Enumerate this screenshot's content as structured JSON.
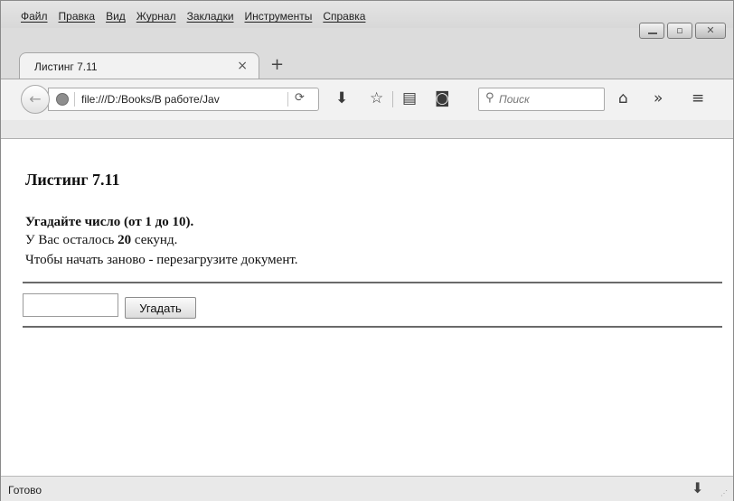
{
  "menu": {
    "items": [
      "Файл",
      "Правка",
      "Вид",
      "Журнал",
      "Закладки",
      "Инструменты",
      "Справка"
    ]
  },
  "tab": {
    "title": "Листинг 7.11",
    "close_glyph": "×",
    "new_tab_glyph": "+"
  },
  "navbar": {
    "back_glyph": "←",
    "url": "file:///D:/Books/В работе/Jav",
    "reload_glyph": "C",
    "search_placeholder": "Поиск",
    "icons": [
      "download-icon",
      "bookmark-star-icon",
      "reading-list-icon",
      "pocket-icon",
      "home-icon",
      "overflow-icon",
      "hamburger-menu-icon"
    ]
  },
  "page": {
    "heading": "Листинг 7.11",
    "prompt": "Угадайте число (от 1 до 10).",
    "time_prefix": "У Вас осталось ",
    "time_value": "20",
    "time_suffix": " секунд.",
    "restart_hint": "Чтобы начать заново - перезагрузите документ.",
    "guess_value": "",
    "guess_button": "Угадать"
  },
  "status": {
    "text": "Готово"
  }
}
